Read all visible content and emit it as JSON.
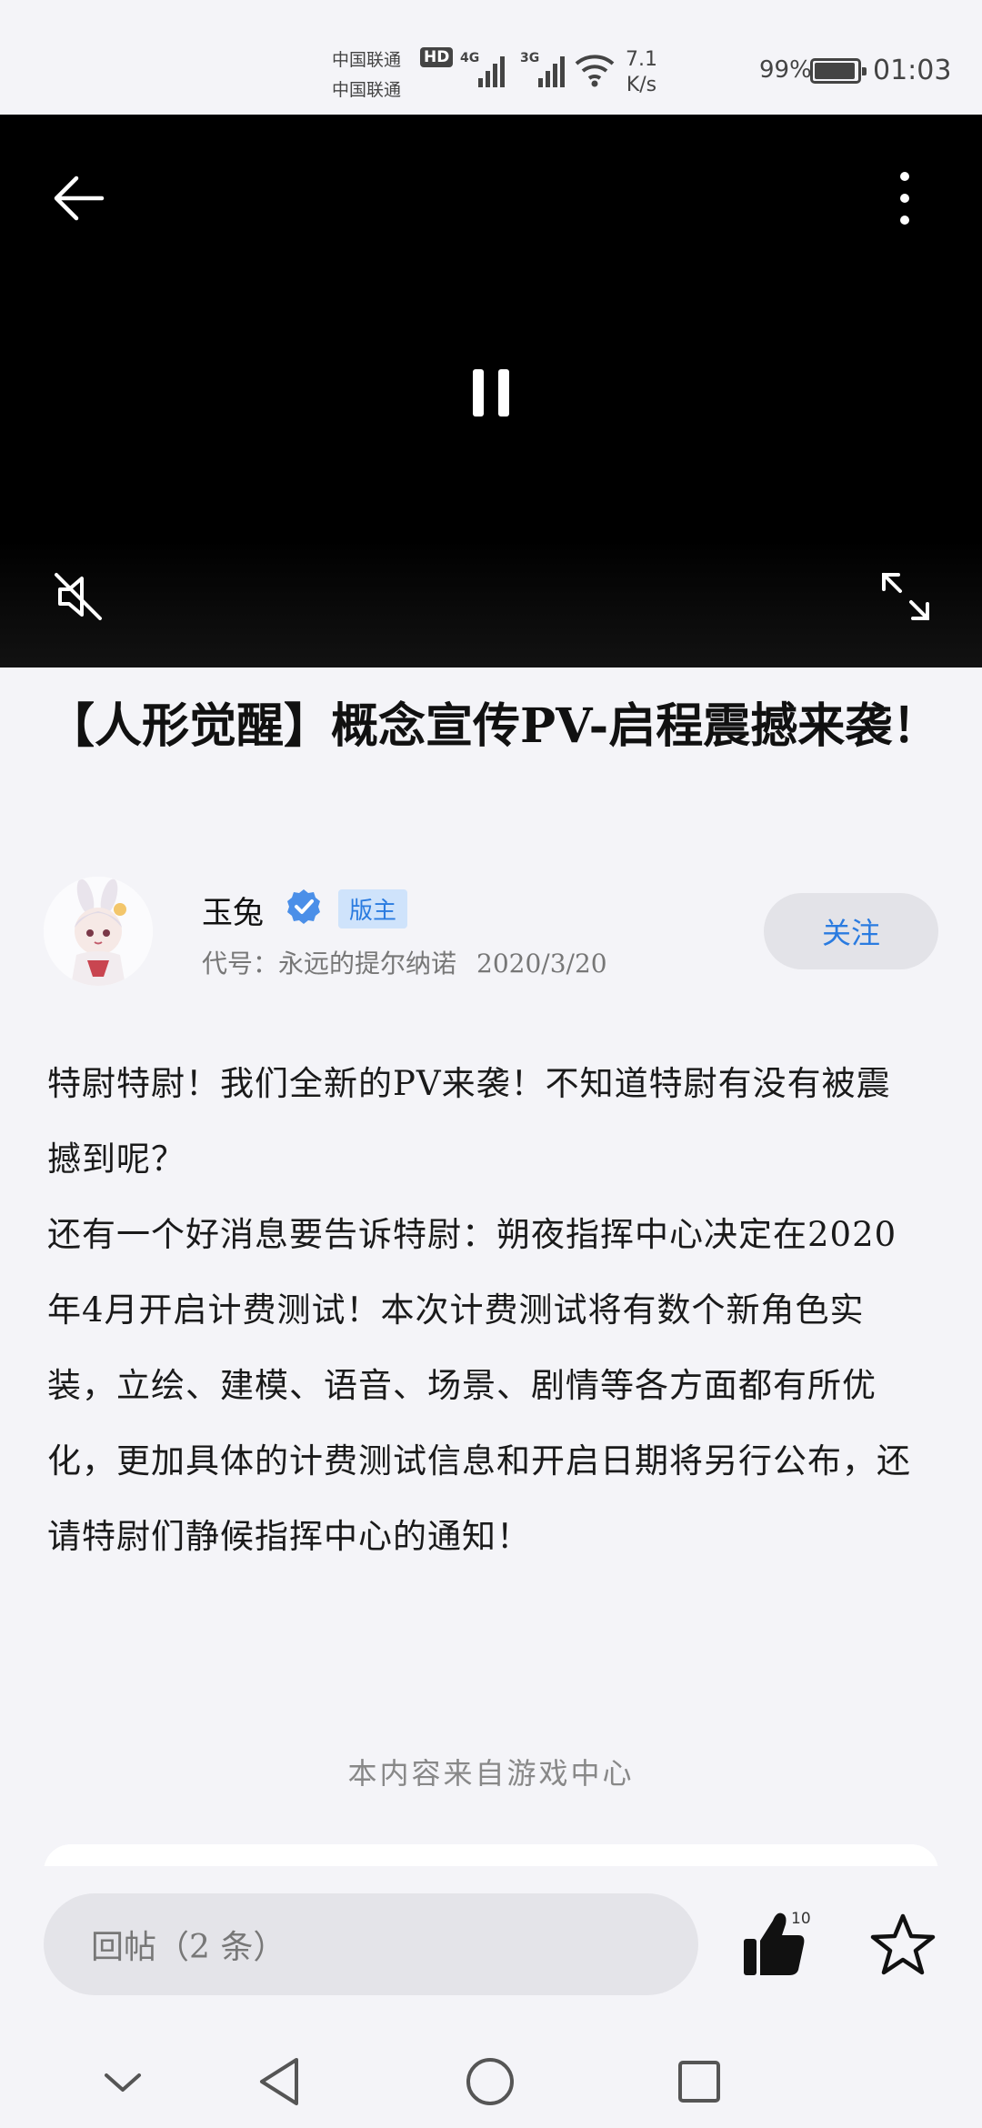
{
  "status_bar": {
    "carrier_1": "中国联通",
    "carrier_2": "中国联通",
    "hd_badge": "HD",
    "signal_1_type": "4G",
    "signal_2_type": "3G",
    "speed_value": "7.1",
    "speed_unit": "K/s",
    "battery_percent": "99%",
    "battery_level": 0.99,
    "time": "01:03"
  },
  "video_player": {
    "back_icon": "arrow-left-icon",
    "more_icon": "more-vertical-icon",
    "play_state_icon": "pause-icon",
    "mute_icon": "volume-muted-icon",
    "fullscreen_icon": "expand-icon"
  },
  "post": {
    "title": "【人形觉醒】概念宣传PV-启程震撼来袭！",
    "author": {
      "name": "玉兔",
      "role_badge": "版主",
      "codename": "代号：永远的提尔纳诺",
      "date": "2020/3/20"
    },
    "follow_label": "关注",
    "paragraphs": [
      "特尉特尉！我们全新的PV来袭！不知道特尉有没有被震撼到呢？",
      "还有一个好消息要告诉特尉：朔夜指挥中心决定在2020年4月开启计费测试！本次计费测试将有数个新角色实装，立绘、建模、语音、场景、剧情等各方面都有所优化，更加具体的计费测试信息和开启日期将另行公布，还请特尉们静候指挥中心的通知！"
    ],
    "source_note": "本内容来自游戏中心"
  },
  "bottom_bar": {
    "reply_placeholder": "回帖（2 条）",
    "like_count": "10",
    "like_icon": "thumbs-up-icon",
    "favorite_icon": "star-icon"
  },
  "nav_bar": {
    "icons": [
      "chevron-down-icon",
      "back-triangle-icon",
      "home-circle-icon",
      "recents-square-icon"
    ]
  },
  "colors": {
    "accent_blue": "#2a7be0",
    "role_badge_bg": "#cfe3fb",
    "page_bg": "#f4f4f8",
    "video_bg": "#000000"
  }
}
